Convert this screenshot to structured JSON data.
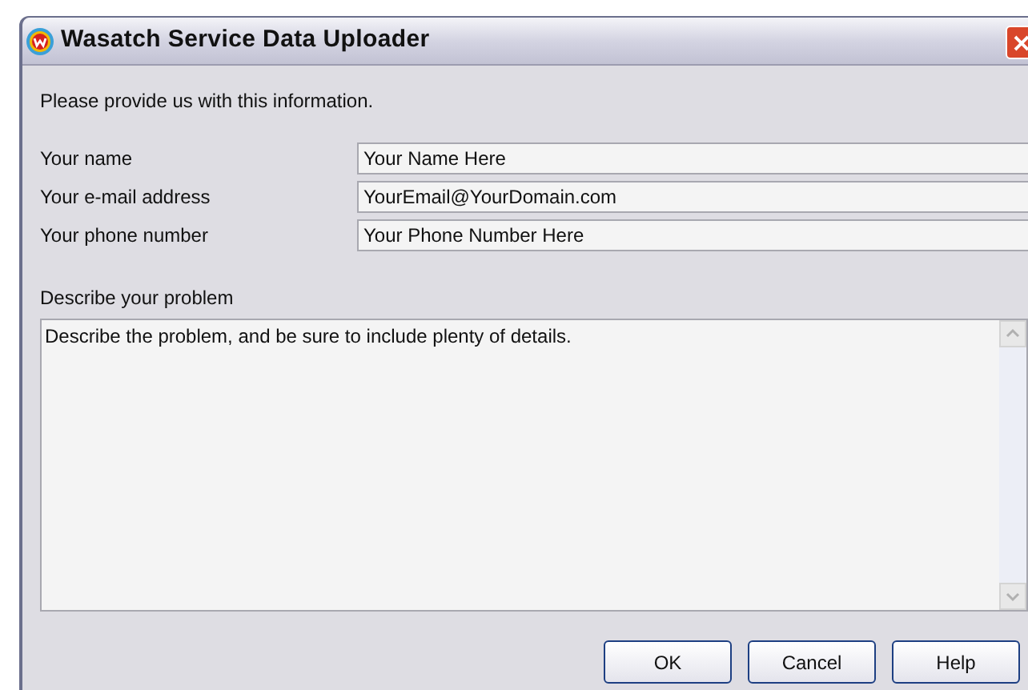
{
  "window": {
    "title": "Wasatch Service Data Uploader"
  },
  "intro": "Please provide us with this information.",
  "fields": [
    {
      "label": "Your name",
      "value": "Your Name Here"
    },
    {
      "label": "Your e-mail address",
      "value": "YourEmail@YourDomain.com"
    },
    {
      "label": "Your phone number",
      "value": "Your Phone Number Here"
    }
  ],
  "problem": {
    "label": "Describe your problem",
    "value": "Describe the problem, and be sure to include plenty of details."
  },
  "buttons": [
    "OK",
    "Cancel",
    "Help"
  ]
}
